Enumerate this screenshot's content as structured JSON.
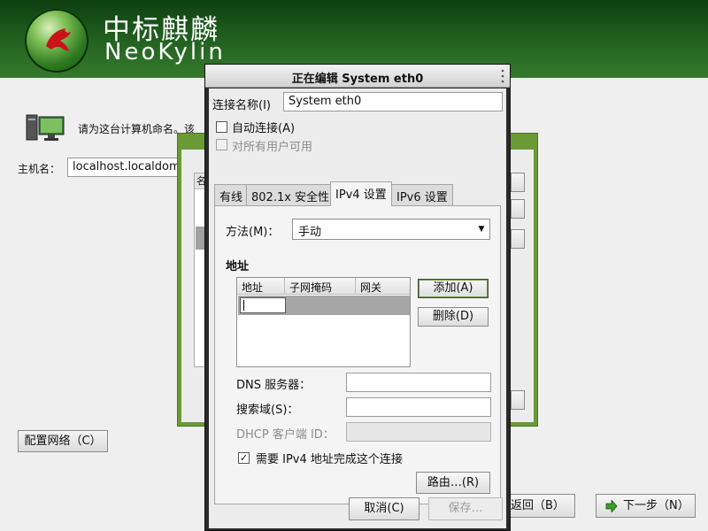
{
  "banner": {
    "brand_cn": "中标麒麟",
    "brand_en": "NeoKylin"
  },
  "installer": {
    "prompt": "请为这台计算机命名。该",
    "hostname_label": "主机名：",
    "hostname_value": "localhost.localdom",
    "config_network_button": "配置网络（C）",
    "back_button": "返回（B）",
    "next_button": "下一步（N）"
  },
  "netconn_window": {
    "list_header": "名"
  },
  "dialog": {
    "title": "正在编辑 System eth0",
    "conn_name_label": "连接名称(I)",
    "conn_name_value": "System eth0",
    "auto_connect_label": "自动连接(A)",
    "auto_connect_checked": false,
    "all_users_label": "对所有用户可用",
    "all_users_checked": false,
    "tabs": [
      {
        "label": "有线",
        "active": false
      },
      {
        "label": "802.1x 安全性",
        "active": false
      },
      {
        "label": "IPv4 设置",
        "active": true
      },
      {
        "label": "IPv6 设置",
        "active": false
      }
    ],
    "ipv4": {
      "method_label": "方法(M)：",
      "method_value": "手动",
      "addresses_heading": "地址",
      "columns": [
        "地址",
        "子网掩码",
        "网关"
      ],
      "add_button": "添加(A)",
      "delete_button": "删除(D)",
      "dns_label": "DNS 服务器：",
      "dns_value": "",
      "search_label": "搜索域(S)：",
      "search_value": "",
      "dhcp_label": "DHCP 客户端 ID：",
      "dhcp_value": "",
      "require_ipv4_label": "需要 IPv4 地址完成这个连接",
      "require_ipv4_checked": true,
      "routes_button": "路由…(R)"
    },
    "cancel_button": "取消(C)",
    "save_button": "保存…"
  },
  "colors": {
    "banner_green": "#1d5a1c",
    "window_green": "#6a9a36",
    "dialog_frame": "#2a2a2a"
  }
}
